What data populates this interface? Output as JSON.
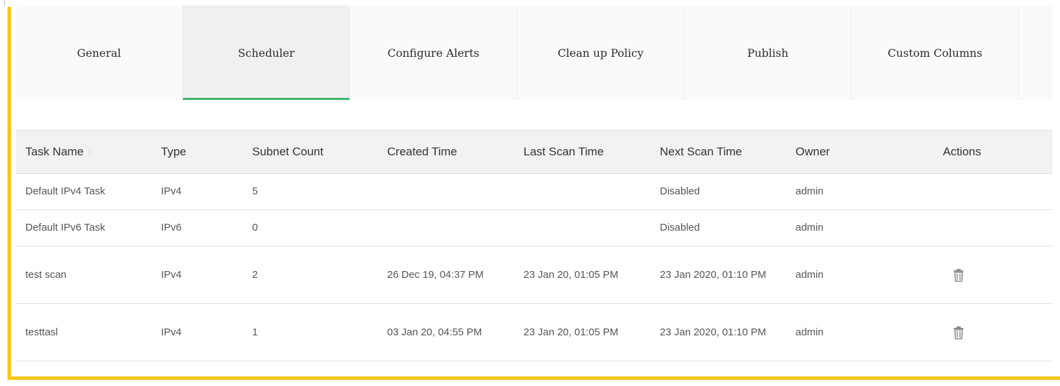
{
  "tabs": [
    {
      "label": "General",
      "active": false
    },
    {
      "label": "Scheduler",
      "active": true
    },
    {
      "label": "Configure Alerts",
      "active": false
    },
    {
      "label": "Clean up Policy",
      "active": false
    },
    {
      "label": "Publish",
      "active": false
    },
    {
      "label": "Custom Columns",
      "active": false
    }
  ],
  "table": {
    "headers": {
      "task_name": "Task Name",
      "type": "Type",
      "subnet_count": "Subnet Count",
      "created_time": "Created Time",
      "last_scan_time": "Last Scan Time",
      "next_scan_time": "Next Scan Time",
      "owner": "Owner",
      "actions": "Actions"
    },
    "sort_indicator": "↕",
    "rows": [
      {
        "task_name": "Default IPv4 Task",
        "type": "IPv4",
        "subnet_count": "5",
        "created_time": "",
        "last_scan_time": "",
        "next_scan_time": "Disabled",
        "owner": "admin",
        "has_delete": false
      },
      {
        "task_name": "Default IPv6 Task",
        "type": "IPv6",
        "subnet_count": "0",
        "created_time": "",
        "last_scan_time": "",
        "next_scan_time": "Disabled",
        "owner": "admin",
        "has_delete": false
      },
      {
        "task_name": "test scan",
        "type": "IPv4",
        "subnet_count": "2",
        "created_time": "26 Dec 19, 04:37 PM",
        "last_scan_time": "23 Jan 20, 01:05 PM",
        "next_scan_time": "23 Jan 2020, 01:10 PM",
        "owner": "admin",
        "has_delete": true
      },
      {
        "task_name": "testtasl",
        "type": "IPv4",
        "subnet_count": "1",
        "created_time": "03 Jan 20, 04:55 PM",
        "last_scan_time": "23 Jan 20, 01:05 PM",
        "next_scan_time": "23 Jan 2020, 01:10 PM",
        "owner": "admin",
        "has_delete": true
      }
    ]
  },
  "colors": {
    "frame_accent": "#f5c518",
    "active_tab_underline": "#3cb371"
  }
}
